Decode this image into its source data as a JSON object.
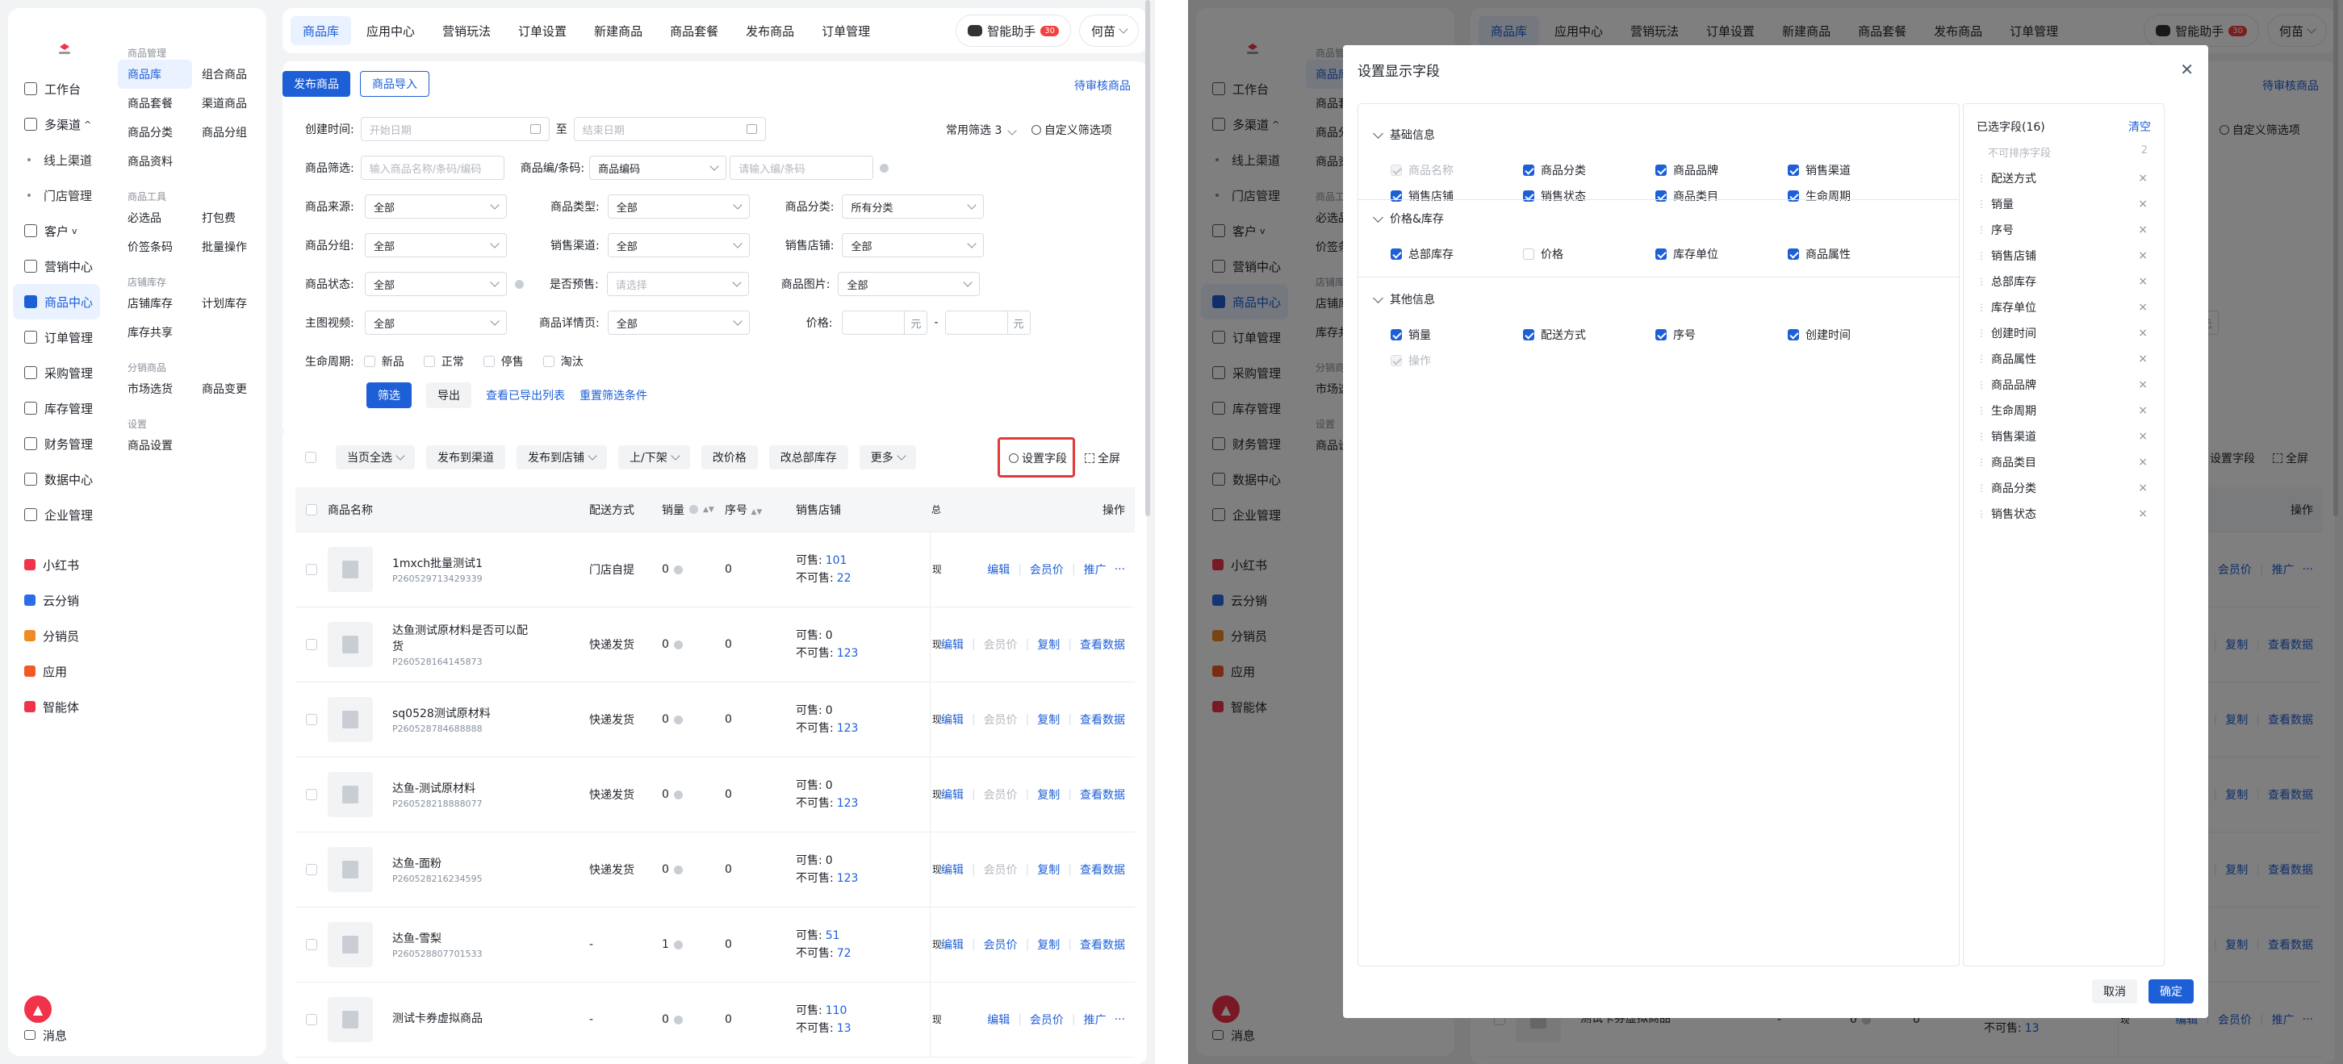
{
  "sidebar": {
    "primary": [
      {
        "label": "工作台",
        "icon": "desktop-icon"
      },
      {
        "label": "多渠道",
        "icon": "channel-icon",
        "suffix": "^"
      },
      {
        "label": "线上渠道",
        "sub": true
      },
      {
        "label": "门店管理",
        "sub": true
      },
      {
        "label": "客户",
        "icon": "user-icon",
        "suffix": "v"
      },
      {
        "label": "营销中心",
        "icon": "marketing-icon"
      },
      {
        "label": "商品中心",
        "icon": "bag-icon",
        "active": true
      },
      {
        "label": "订单管理",
        "icon": "order-icon"
      },
      {
        "label": "采购管理",
        "icon": "cart-icon"
      },
      {
        "label": "库存管理",
        "icon": "warehouse-icon"
      },
      {
        "label": "财务管理",
        "icon": "finance-icon"
      },
      {
        "label": "数据中心",
        "icon": "chart-icon"
      },
      {
        "label": "企业管理",
        "icon": "building-icon"
      }
    ],
    "apps": [
      {
        "label": "小红书",
        "color": "#f0334a"
      },
      {
        "label": "云分销",
        "color": "#2b6de8"
      },
      {
        "label": "分销员",
        "color": "#f08a24"
      },
      {
        "label": "应用",
        "color": "#f05a24"
      },
      {
        "label": "智能体",
        "color": "#f0334a"
      }
    ],
    "message": "消息",
    "sections": [
      {
        "title": "商品管理",
        "items": [
          "商品库",
          "组合商品",
          "商品套餐",
          "渠道商品",
          "商品分类",
          "商品分组",
          "商品资料"
        ]
      },
      {
        "title": "商品工具",
        "items": [
          "必选品",
          "打包费",
          "价签条码",
          "批量操作"
        ]
      },
      {
        "title": "店铺库存",
        "items": [
          "店铺库存",
          "计划库存",
          "库存共享"
        ]
      },
      {
        "title": "分销商品",
        "items": [
          "市场选货",
          "商品变更"
        ]
      },
      {
        "title": "设置",
        "items": [
          "商品设置"
        ]
      }
    ]
  },
  "topbar": {
    "tabs": [
      "商品库",
      "应用中心",
      "营销玩法",
      "订单设置",
      "新建商品",
      "商品套餐",
      "发布商品",
      "订单管理"
    ],
    "assistant": "智能助手",
    "assistant_badge": "30",
    "user": "何苗"
  },
  "actions": {
    "publish": "发布商品",
    "import": "商品导入",
    "pending": "待审核商品"
  },
  "filters": {
    "created_label": "创建时间:",
    "start_ph": "开始日期",
    "to": "至",
    "end_ph": "结束日期",
    "common": "常用筛选 3",
    "custom": "自定义筛选项",
    "product_filter_label": "商品筛选:",
    "product_filter_ph": "输入商品名称/条码/编码",
    "code_label": "商品编/条码:",
    "code_value": "商品编码",
    "code_ph": "请输入编/条码",
    "source_label": "商品来源:",
    "source_value": "全部",
    "type_label": "商品类型:",
    "type_value": "全部",
    "cat_label": "商品分类:",
    "cat_value": "所有分类",
    "group_label": "商品分组:",
    "group_value": "全部",
    "channel_label": "销售渠道:",
    "channel_value": "全部",
    "store_label": "销售店铺:",
    "store_value": "全部",
    "status_label": "商品状态:",
    "status_value": "全部",
    "presale_label": "是否预售:",
    "presale_ph": "请选择",
    "image_label": "商品图片:",
    "image_value": "全部",
    "video_label": "主图视频:",
    "video_value": "全部",
    "detail_label": "商品详情页:",
    "detail_value": "全部",
    "price_label": "价格:",
    "price_unit": "元",
    "dash": "-",
    "lifecycle_label": "生命周期:",
    "lifecycle": [
      "新品",
      "正常",
      "停售",
      "淘汰"
    ],
    "search": "筛选",
    "export": "导出",
    "view_export": "查看已导出列表",
    "reset": "重置筛选条件"
  },
  "toolbar": {
    "select": "当页全选",
    "to_channel": "发布到渠道",
    "to_store": "发布到店铺",
    "updown": "上/下架",
    "price": "改价格",
    "stock": "改总部库存",
    "more": "更多",
    "set_fields": "设置字段",
    "fullscreen": "全屏"
  },
  "table": {
    "headers": {
      "name": "商品名称",
      "delivery": "配送方式",
      "sales": "销量",
      "seq": "序号",
      "store": "销售店铺",
      "total": "总",
      "ops": "操作"
    },
    "rows": [
      {
        "name": "1mxch批量测试1",
        "code": "P260529713429339",
        "delivery": "门店自提",
        "sales": "0",
        "seq": "0",
        "ok": "101",
        "no": "22",
        "ops": [
          "编辑",
          "会员价",
          "推广",
          "···"
        ],
        "dim": [
          false,
          false,
          false,
          false
        ]
      },
      {
        "name": "达鱼测试原材料是否可以配货",
        "code": "P260528164145873",
        "delivery": "快递发货",
        "sales": "0",
        "seq": "0",
        "ok": "0",
        "no": "123",
        "ops": [
          "编辑",
          "会员价",
          "复制",
          "查看数据"
        ],
        "dim": [
          false,
          true,
          false,
          false
        ]
      },
      {
        "name": "sq0528测试原材料",
        "code": "P260528784688888",
        "delivery": "快递发货",
        "sales": "0",
        "seq": "0",
        "ok": "0",
        "no": "123",
        "ops": [
          "编辑",
          "会员价",
          "复制",
          "查看数据"
        ],
        "dim": [
          false,
          true,
          false,
          false
        ]
      },
      {
        "name": "达鱼-测试原材料",
        "code": "P260528218888077",
        "delivery": "快递发货",
        "sales": "0",
        "seq": "0",
        "ok": "0",
        "no": "123",
        "ops": [
          "编辑",
          "会员价",
          "复制",
          "查看数据"
        ],
        "dim": [
          false,
          true,
          false,
          false
        ]
      },
      {
        "name": "达鱼-面粉",
        "code": "P260528216234595",
        "delivery": "快递发货",
        "sales": "0",
        "seq": "0",
        "ok": "0",
        "no": "123",
        "ops": [
          "编辑",
          "会员价",
          "复制",
          "查看数据"
        ],
        "dim": [
          false,
          true,
          false,
          false
        ]
      },
      {
        "name": "达鱼-雪梨",
        "code": "P260528807701533",
        "delivery": "-",
        "sales": "1",
        "seq": "0",
        "ok": "51",
        "no": "72",
        "ops": [
          "编辑",
          "会员价",
          "复制",
          "查看数据"
        ],
        "dim": [
          false,
          false,
          false,
          false
        ]
      },
      {
        "name": "测试卡券虚拟商品",
        "code": "",
        "delivery": "-",
        "sales": "0",
        "seq": "0",
        "ok": "110",
        "no": "13",
        "ops": [
          "编辑",
          "会员价",
          "推广",
          "···"
        ],
        "dim": [
          false,
          false,
          false,
          false
        ]
      }
    ],
    "ok_label": "可售:",
    "no_label": "不可售:",
    "total_cut": "现:"
  },
  "modal": {
    "title": "设置显示字段",
    "groups": [
      {
        "title": "基础信息",
        "fields": [
          {
            "label": "商品名称",
            "state": "dis"
          },
          {
            "label": "商品分类",
            "state": "on"
          },
          {
            "label": "商品品牌",
            "state": "on"
          },
          {
            "label": "销售渠道",
            "state": "on"
          },
          {
            "label": "销售店铺",
            "state": "on"
          },
          {
            "label": "销售状态",
            "state": "on"
          },
          {
            "label": "商品类目",
            "state": "on"
          },
          {
            "label": "生命周期",
            "state": "on"
          }
        ]
      },
      {
        "title": "价格&库存",
        "fields": [
          {
            "label": "总部库存",
            "state": "on"
          },
          {
            "label": "价格",
            "state": "off"
          },
          {
            "label": "库存单位",
            "state": "on"
          },
          {
            "label": "商品属性",
            "state": "on"
          }
        ]
      },
      {
        "title": "其他信息",
        "fields": [
          {
            "label": "销量",
            "state": "on"
          },
          {
            "label": "配送方式",
            "state": "on"
          },
          {
            "label": "序号",
            "state": "on"
          },
          {
            "label": "创建时间",
            "state": "on"
          },
          {
            "label": "操作",
            "state": "dis"
          }
        ]
      }
    ],
    "selected_title": "已选字段(16)",
    "clear": "清空",
    "fixed_label": "不可排序字段",
    "fixed_count": "2",
    "selected": [
      "配送方式",
      "销量",
      "序号",
      "销售店铺",
      "总部库存",
      "库存单位",
      "创建时间",
      "商品属性",
      "商品品牌",
      "生命周期",
      "销售渠道",
      "商品类目",
      "商品分类",
      "销售状态"
    ],
    "cancel": "取消",
    "ok": "确定"
  }
}
